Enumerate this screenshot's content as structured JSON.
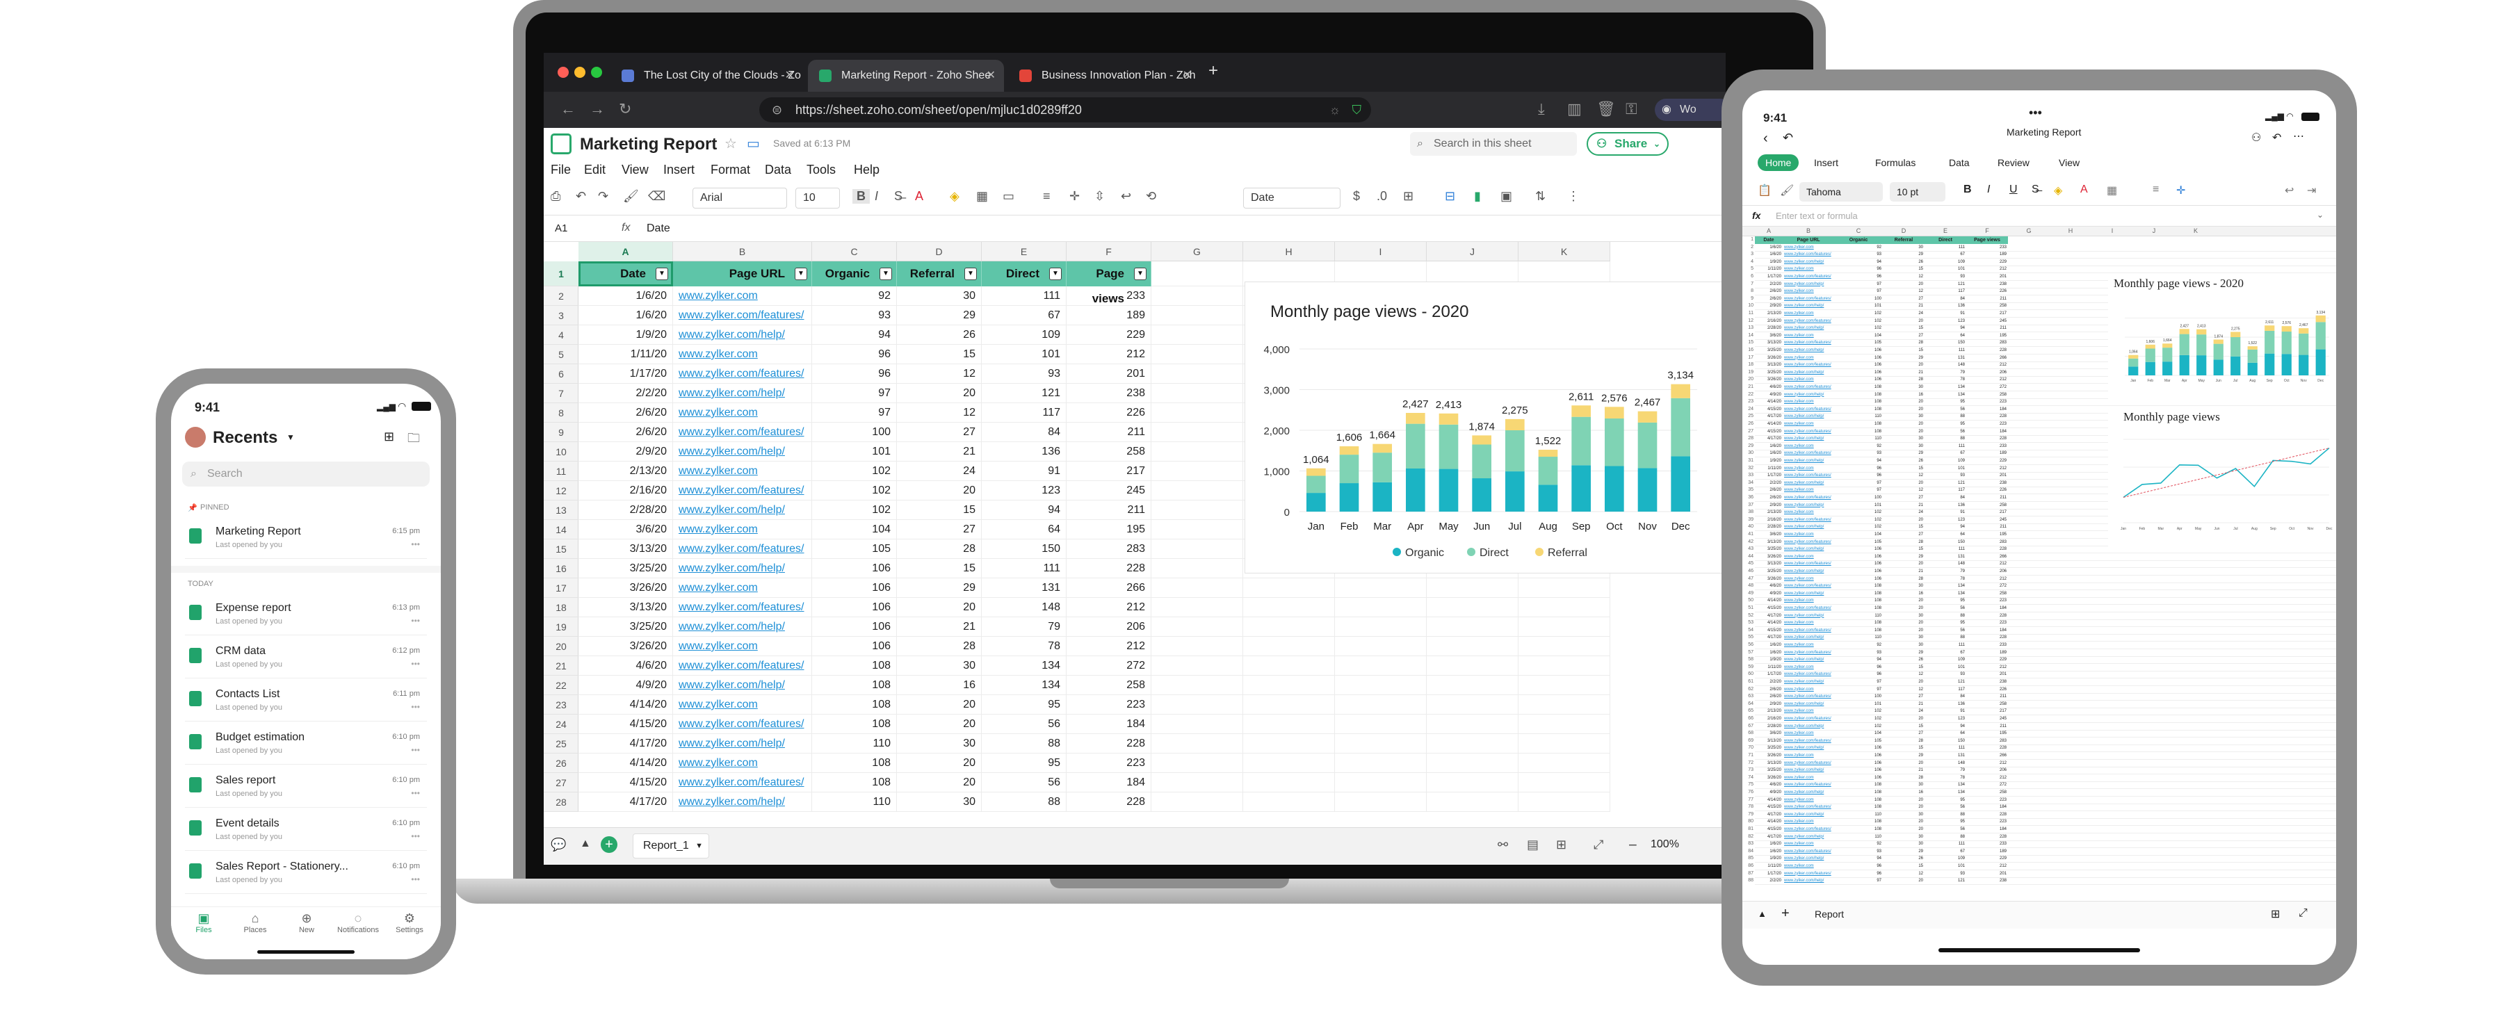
{
  "browser": {
    "tabs": [
      {
        "title": "The Lost City of the Clouds - Zo",
        "active": false
      },
      {
        "title": "Marketing Report - Zoho Shee",
        "active": true
      },
      {
        "title": "Business Innovation Plan - Zoh",
        "active": false
      }
    ],
    "url": "https://sheet.zoho.com/sheet/open/mjluc1d0289ff20",
    "profile_label": "Wo"
  },
  "app": {
    "doc_title": "Marketing Report",
    "saved_status": "Saved at 6:13 PM",
    "search_placeholder": "Search in this sheet",
    "share_label": "Share",
    "menu": [
      "File",
      "Edit",
      "View",
      "Insert",
      "Format",
      "Data",
      "Tools",
      "Help"
    ],
    "font": "Arial",
    "font_size": "10",
    "number_format": "Date",
    "cell_ref": "A1",
    "formula": "Date",
    "columns": [
      "A",
      "B",
      "C",
      "D",
      "E",
      "F",
      "G",
      "H",
      "I",
      "J",
      "K"
    ],
    "headers": [
      "Date",
      "Page URL",
      "Organic",
      "Referral",
      "Direct",
      "Page views"
    ],
    "rows": [
      [
        "1/6/20",
        "www.zylker.com",
        "92",
        "30",
        "111",
        "233"
      ],
      [
        "1/6/20",
        "www.zylker.com/features/",
        "93",
        "29",
        "67",
        "189"
      ],
      [
        "1/9/20",
        "www.zylker.com/help/",
        "94",
        "26",
        "109",
        "229"
      ],
      [
        "1/11/20",
        "www.zylker.com",
        "96",
        "15",
        "101",
        "212"
      ],
      [
        "1/17/20",
        "www.zylker.com/features/",
        "96",
        "12",
        "93",
        "201"
      ],
      [
        "2/2/20",
        "www.zylker.com/help/",
        "97",
        "20",
        "121",
        "238"
      ],
      [
        "2/6/20",
        "www.zylker.com",
        "97",
        "12",
        "117",
        "226"
      ],
      [
        "2/6/20",
        "www.zylker.com/features/",
        "100",
        "27",
        "84",
        "211"
      ],
      [
        "2/9/20",
        "www.zylker.com/help/",
        "101",
        "21",
        "136",
        "258"
      ],
      [
        "2/13/20",
        "www.zylker.com",
        "102",
        "24",
        "91",
        "217"
      ],
      [
        "2/16/20",
        "www.zylker.com/features/",
        "102",
        "20",
        "123",
        "245"
      ],
      [
        "2/28/20",
        "www.zylker.com/help/",
        "102",
        "15",
        "94",
        "211"
      ],
      [
        "3/6/20",
        "www.zylker.com",
        "104",
        "27",
        "64",
        "195"
      ],
      [
        "3/13/20",
        "www.zylker.com/features/",
        "105",
        "28",
        "150",
        "283"
      ],
      [
        "3/25/20",
        "www.zylker.com/help/",
        "106",
        "15",
        "111",
        "228"
      ],
      [
        "3/26/20",
        "www.zylker.com",
        "106",
        "29",
        "131",
        "266"
      ],
      [
        "3/13/20",
        "www.zylker.com/features/",
        "106",
        "20",
        "148",
        "212"
      ],
      [
        "3/25/20",
        "www.zylker.com/help/",
        "106",
        "21",
        "79",
        "206"
      ],
      [
        "3/26/20",
        "www.zylker.com",
        "106",
        "28",
        "78",
        "212"
      ],
      [
        "4/6/20",
        "www.zylker.com/features/",
        "108",
        "30",
        "134",
        "272"
      ],
      [
        "4/9/20",
        "www.zylker.com/help/",
        "108",
        "16",
        "134",
        "258"
      ],
      [
        "4/14/20",
        "www.zylker.com",
        "108",
        "20",
        "95",
        "223"
      ],
      [
        "4/15/20",
        "www.zylker.com/features/",
        "108",
        "20",
        "56",
        "184"
      ],
      [
        "4/17/20",
        "www.zylker.com/help/",
        "110",
        "30",
        "88",
        "228"
      ],
      [
        "4/14/20",
        "www.zylker.com",
        "108",
        "20",
        "95",
        "223"
      ],
      [
        "4/15/20",
        "www.zylker.com/features/",
        "108",
        "20",
        "56",
        "184"
      ],
      [
        "4/17/20",
        "www.zylker.com/help/",
        "110",
        "30",
        "88",
        "228"
      ]
    ],
    "sheet_tab": "Report_1",
    "zoom": "100%"
  },
  "chart_data": [
    {
      "type": "bar",
      "stacked": true,
      "title": "Monthly page views - 2020",
      "categories": [
        "Jan",
        "Feb",
        "Mar",
        "Apr",
        "May",
        "Jun",
        "Jul",
        "Aug",
        "Sep",
        "Oct",
        "Nov",
        "Dec"
      ],
      "series": [
        {
          "name": "Organic",
          "color": "#1bb4c4",
          "values": [
            460,
            700,
            720,
            1060,
            1050,
            820,
            990,
            660,
            1140,
            1120,
            1070,
            1360
          ]
        },
        {
          "name": "Direct",
          "color": "#7fd3b4",
          "values": [
            420,
            700,
            730,
            1100,
            1090,
            830,
            1010,
            690,
            1190,
            1170,
            1120,
            1430
          ]
        },
        {
          "name": "Referral",
          "color": "#f7d774",
          "values": [
            184,
            206,
            214,
            267,
            273,
            224,
            275,
            172,
            281,
            286,
            277,
            344
          ]
        }
      ],
      "totals": [
        1064,
        1606,
        1664,
        2427,
        2413,
        1874,
        2275,
        1522,
        2611,
        2576,
        2467,
        3134
      ],
      "yticks": [
        "0",
        "1,000",
        "2,000",
        "3,000",
        "4,000"
      ],
      "ylim": [
        0,
        4000
      ],
      "legend": "bottom"
    }
  ],
  "phone": {
    "time": "9:41",
    "header": "Recents",
    "search_placeholder": "Search",
    "pinned_label": "PINNED",
    "today_label": "TODAY",
    "pinned": [
      {
        "name": "Marketing Report",
        "sub": "Last opened by you",
        "time": "6:15 pm"
      }
    ],
    "items": [
      {
        "name": "Expense report",
        "sub": "Last opened by you",
        "time": "6:13 pm"
      },
      {
        "name": "CRM data",
        "sub": "Last opened by you",
        "time": "6:12 pm"
      },
      {
        "name": "Contacts List",
        "sub": "Last opened by you",
        "time": "6:11 pm"
      },
      {
        "name": "Budget estimation",
        "sub": "Last opened by you",
        "time": "6:10 pm"
      },
      {
        "name": "Sales report",
        "sub": "Last opened by you",
        "time": "6:10 pm"
      },
      {
        "name": "Event details",
        "sub": "Last opened by you",
        "time": "6:10 pm"
      },
      {
        "name": "Sales Report - Stationery...",
        "sub": "Last opened by you",
        "time": "6:10 pm"
      }
    ],
    "tabs": [
      "Files",
      "Places",
      "New",
      "Notifications",
      "Settings"
    ]
  },
  "tablet": {
    "time": "9:41",
    "title": "Marketing Report",
    "ribbon_tabs": [
      "Home",
      "Insert",
      "Formulas",
      "Data",
      "Review",
      "View"
    ],
    "font": "Tahoma",
    "font_size": "10 pt",
    "formula_placeholder": "Enter text or formula",
    "columns": [
      "A",
      "B",
      "C",
      "D",
      "E",
      "F",
      "G",
      "H",
      "I",
      "J",
      "K"
    ],
    "headers": [
      "Date",
      "Page URL",
      "Organic",
      "Referral",
      "Direct",
      "Page views"
    ],
    "chart1_title": "Monthly page views - 2020",
    "chart2_title": "Monthly page views",
    "sheet_tab": "Report"
  }
}
